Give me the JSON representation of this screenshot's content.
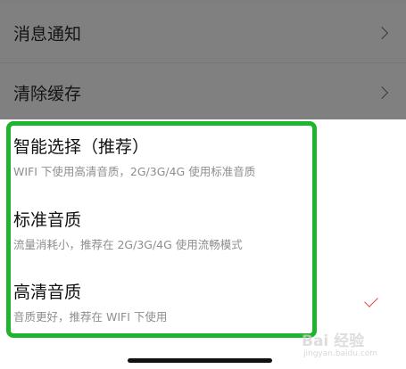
{
  "settings": {
    "items": [
      {
        "label": "消息通知"
      },
      {
        "label": "清除缓存"
      }
    ]
  },
  "sheet": {
    "options": [
      {
        "title": "智能选择（推荐）",
        "description": "WIFI 下使用高清音质，2G/3G/4G 使用标准音质",
        "selected": false
      },
      {
        "title": "标准音质",
        "description": "流量消耗小，推荐在 2G/3G/4G 使用流畅模式",
        "selected": false
      },
      {
        "title": "高清音质",
        "description": "音质更好，推荐在 WIFI 下使用",
        "selected": true
      }
    ]
  },
  "colors": {
    "highlight": "#1db52b",
    "check": "#e1443a"
  },
  "watermark": {
    "text": "Bai 经验",
    "sub": "jingyan.baidu.com"
  }
}
